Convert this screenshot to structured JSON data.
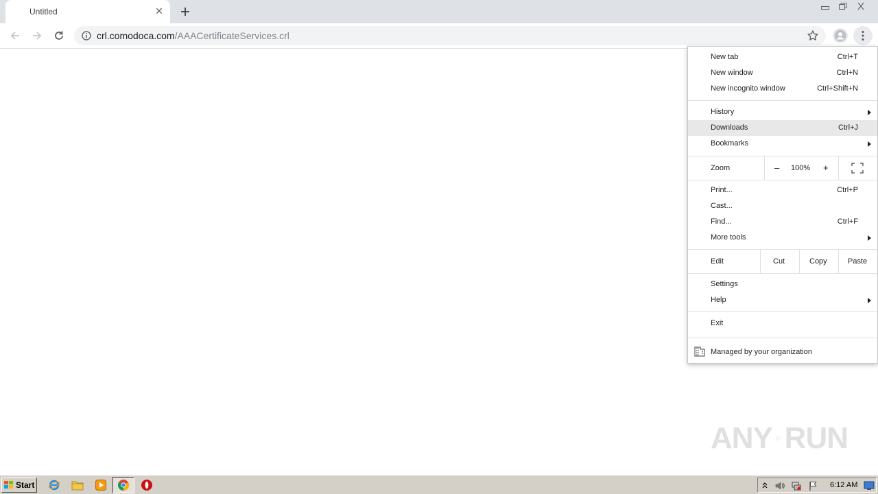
{
  "tab": {
    "title": "Untitled"
  },
  "omnibox": {
    "host": "crl.comodoca.com",
    "path": "/AAACertificateServices.crl"
  },
  "menu": {
    "new_tab": {
      "label": "New tab",
      "shortcut": "Ctrl+T"
    },
    "new_window": {
      "label": "New window",
      "shortcut": "Ctrl+N"
    },
    "new_incognito": {
      "label": "New incognito window",
      "shortcut": "Ctrl+Shift+N"
    },
    "history": {
      "label": "History"
    },
    "downloads": {
      "label": "Downloads",
      "shortcut": "Ctrl+J"
    },
    "bookmarks": {
      "label": "Bookmarks"
    },
    "zoom": {
      "label": "Zoom",
      "minus": "–",
      "value": "100%",
      "plus": "+"
    },
    "print": {
      "label": "Print...",
      "shortcut": "Ctrl+P"
    },
    "cast": {
      "label": "Cast..."
    },
    "find": {
      "label": "Find...",
      "shortcut": "Ctrl+F"
    },
    "more_tools": {
      "label": "More tools"
    },
    "edit": {
      "label": "Edit",
      "cut": "Cut",
      "copy": "Copy",
      "paste": "Paste"
    },
    "settings": {
      "label": "Settings"
    },
    "help": {
      "label": "Help"
    },
    "exit": {
      "label": "Exit"
    },
    "managed": {
      "label": "Managed by your organization"
    }
  },
  "watermark": {
    "left": "ANY",
    "right": "RUN"
  },
  "taskbar": {
    "start_label": "Start",
    "clock": "6:12 AM"
  },
  "colors": {
    "menu_highlight": "#e8e8e9",
    "tabstrip": "#dee1e6",
    "taskbar": "#d4d0c8"
  }
}
